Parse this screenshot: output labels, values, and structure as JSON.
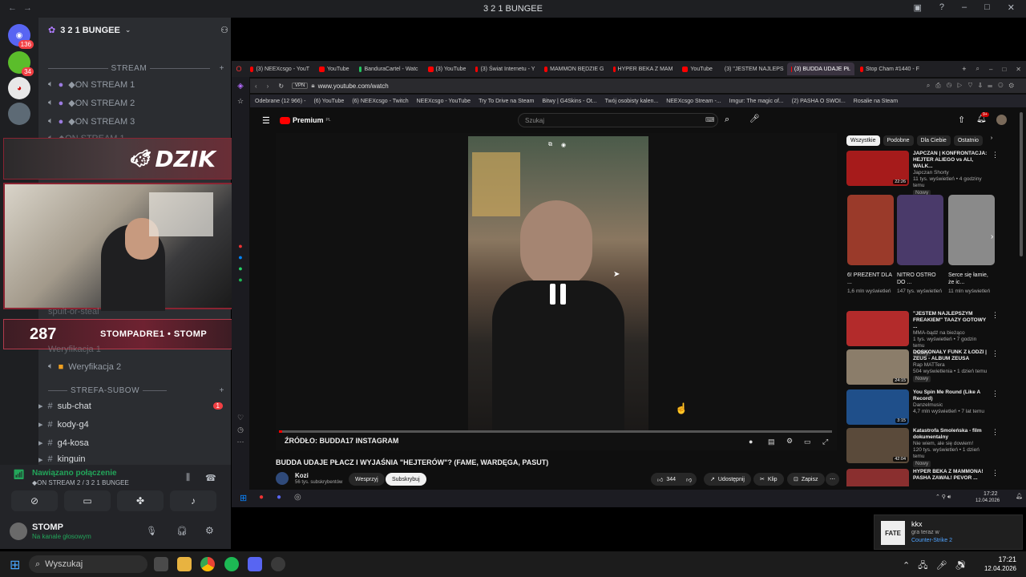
{
  "discord": {
    "window_title": "3 2 1 BUNGEE",
    "guild_name": "3 2 1 BUNGEE",
    "rail_badges": [
      "136",
      "34"
    ],
    "categories": [
      {
        "label": "STREAM"
      },
      {
        "label": "STREFA-SUBOW"
      }
    ],
    "voice_channels": [
      "◆ON STREAM 1",
      "◆ON STREAM 2",
      "◆ON STREAM 3",
      "◆ON STREAM 1"
    ],
    "partial_channels": [
      "spuit-or-steal",
      "Weryfikacja 1"
    ],
    "weryfikacja2": "Weryfikacja 2",
    "text_channels": [
      {
        "label": "sub-chat",
        "badge": "1"
      },
      {
        "label": "kody-g4"
      },
      {
        "label": "g4-kosa"
      },
      {
        "label": "kinguin"
      }
    ],
    "voice_status": {
      "title": "Nawiązano połączenie",
      "sub": "◆ON STREAM 2 / 3 2 1 BUNGEE"
    },
    "user": {
      "name": "STOMP",
      "status": "Na kanale głosowym"
    }
  },
  "overlay": {
    "brand": "DZIK",
    "sub_count": "287",
    "handles": "STOMPADRE1  •  STOMP"
  },
  "browser": {
    "tabs": [
      {
        "label": "(3) NEEXcsgo - YouT",
        "color": "#ff0000"
      },
      {
        "label": "YouTube",
        "color": "#ff0000"
      },
      {
        "label": "BanduraCartel - Watc",
        "color": "#22c55e"
      },
      {
        "label": "(3) YouTube",
        "color": "#ff0000"
      },
      {
        "label": "(3) Świat Internetu - Y",
        "color": "#ff0000"
      },
      {
        "label": "MAMMON BĘDZIE G",
        "color": "#ff0000"
      },
      {
        "label": "HYPER BEKA Z MAM",
        "color": "#ff0000"
      },
      {
        "label": "YouTube",
        "color": "#ff0000"
      },
      {
        "label": "(3) \"JESTEM NAJLEPS",
        "color": "#ff0000"
      },
      {
        "label": "(3) BUDDA UDAJE PŁ",
        "color": "#ff0000",
        "active": true
      },
      {
        "label": "Stop Cham #1440 - F",
        "color": "#ff0000"
      }
    ],
    "url_prefix": "VPN",
    "url": "www.youtube.com/watch",
    "bookmarks": [
      "Odebrane (12 966) -",
      "(6) YouTube",
      "(6) NEEXcsgo - Twitch",
      "NEEXcsgo - YouTube",
      "Try To Drive na Steam",
      "Bitwy | G4Skins - Ot...",
      "Twój osobisty kalen...",
      "NEEXcsgo Stream -...",
      "Imgur: The magic of...",
      "(2) PASHA O SWOI...",
      "Rosalie na Steam"
    ]
  },
  "youtube": {
    "logo": "Premium",
    "logo_sup": "PL",
    "search_placeholder": "Szukaj",
    "notif_badge": "9+",
    "video_title": "BUDDA UDAJE PŁACZ I WYJAŚNIA \"HEJTERÓW\"? (FAME, WARDĘGA, PASUT)",
    "overlay_text": "ŹRÓDŁO: BUDDA17 INSTAGRAM",
    "channel": {
      "name": "Kozi",
      "subs": "56 tys. subskrybentów"
    },
    "buttons": {
      "support": "Wesprzyj",
      "subscribe": "Subskrybuj",
      "likes": "344",
      "share": "Udostępnij",
      "clip": "Klip",
      "save": "Zapisz"
    },
    "chips": [
      "Wszystkie",
      "Podobne",
      "Dla Ciebie",
      "Ostatnio"
    ],
    "recommendations": [
      {
        "title": "JAPCZAN | KONFRONTACJA: HEJTER ALIEGO vs ALI, WALK...",
        "channel": "Japczan Shorty",
        "meta": "11 tys. wyświetleń • 4 godziny temu",
        "badge": "Nowy",
        "duration": "22:26",
        "color": "#a61b1b"
      },
      {
        "title": "\"JESTEM NAJLEPSZYM FREAKIEM\" TAAZY GOTOWY ...",
        "channel": "MMA-bądź na bieżąco",
        "meta": "1 tys. wyświetleń • 7 godzin temu",
        "badge": "Nowy",
        "duration": "",
        "color": "#b32b2b"
      },
      {
        "title": "DOSKONAŁY FUNK Z ŁODZI | ZEUS - ALBUM ZEUSA",
        "channel": "Rap MATTera",
        "meta": "504 wyświetlenia • 1 dzień temu",
        "badge": "Nowy",
        "duration": "24:15",
        "color": "#8b7d6a"
      },
      {
        "title": "You Spin Me Round (Like A Record)",
        "channel": "Danzelmusic",
        "meta": "4,7 mln wyświetleń • 7 lat temu",
        "badge": "",
        "duration": "3:15",
        "color": "#1f4f8a"
      },
      {
        "title": "Katastrofa Smoleńska - film dokumentalny",
        "channel": "Nie wiem, ale się dowiem!",
        "meta": "120 tys. wyświetleń • 1 dzień temu",
        "badge": "Nowy",
        "duration": "42:04",
        "color": "#5a4a3a"
      },
      {
        "title": "HYPER BEKA Z MAMMONA! PASHA ZAWAŁ! PEVOR ...",
        "channel": "",
        "meta": "",
        "badge": "",
        "duration": "",
        "color": "#8a2f2f"
      }
    ],
    "shorts": [
      {
        "title": "6! PREZENT DLA ...",
        "views": "1,6 mln wyświetleń",
        "color": "#9a3a2a"
      },
      {
        "title": "NITRO OSTRO DO ...",
        "views": "147 tys. wyświetleń",
        "color": "#4a3a6a"
      },
      {
        "title": "Serce się łamie, że ic...",
        "views": "11 mln wyświetleń",
        "color": "#8a8a8a"
      }
    ],
    "clock": {
      "time": "17:22",
      "date": "12.04.2026"
    }
  },
  "notification": {
    "name": "kkx",
    "line1": "gra teraz w",
    "game": "Counter-Strike 2",
    "logo": "FATE"
  },
  "taskbar": {
    "search": "Wyszukaj",
    "time": "17:21",
    "date": "12.04.2026"
  },
  "colors": {
    "accent": "#5865f2",
    "danger": "#f23f43",
    "yt_red": "#ff0000"
  }
}
